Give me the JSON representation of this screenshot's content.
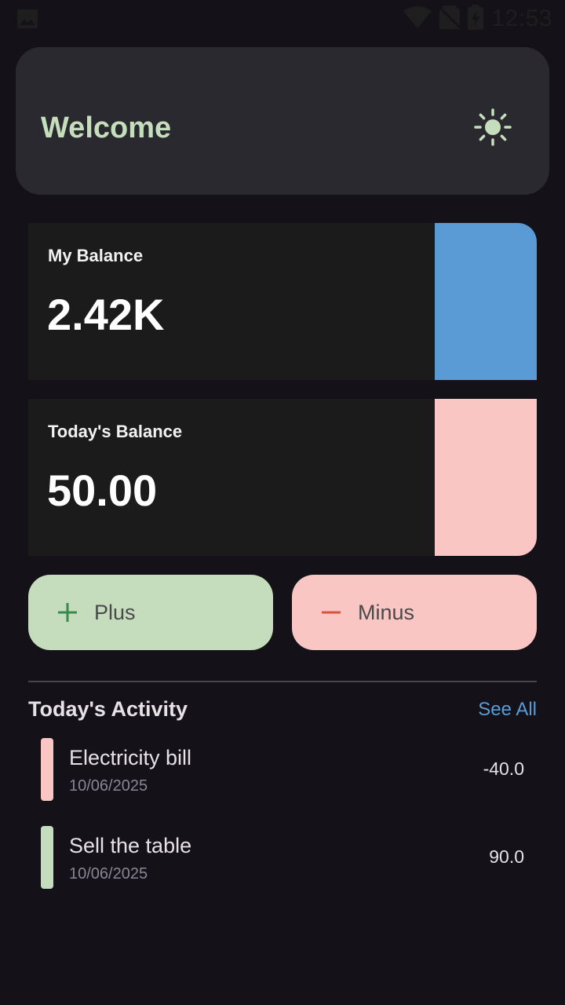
{
  "status_bar": {
    "time": "12:53",
    "icons": [
      "image-icon",
      "wifi-icon",
      "no-sim-icon",
      "battery-charging-icon"
    ]
  },
  "header": {
    "title": "Welcome",
    "theme_icon": "sun-icon"
  },
  "balances": [
    {
      "label": "My Balance",
      "value": "2.42K",
      "accent_color": "#5b9bd5"
    },
    {
      "label": "Today's Balance",
      "value": "50.00",
      "accent_color": "#f9c6c4"
    }
  ],
  "actions": {
    "plus_label": "Plus",
    "minus_label": "Minus"
  },
  "activity": {
    "title": "Today's Activity",
    "see_all": "See All",
    "items": [
      {
        "name": "Electricity bill",
        "date": "10/06/2025",
        "amount": "-40.0",
        "color": "#f9c6c4"
      },
      {
        "name": "Sell the table",
        "date": "10/06/2025",
        "amount": "90.0",
        "color": "#c5dcbd"
      }
    ]
  },
  "colors": {
    "background": "#141218",
    "header_card": "#2b2930",
    "title_green": "#c5dfbd",
    "plus_bg": "#c5dcbd",
    "minus_bg": "#f9c6c4",
    "link_blue": "#5b9bd5"
  }
}
